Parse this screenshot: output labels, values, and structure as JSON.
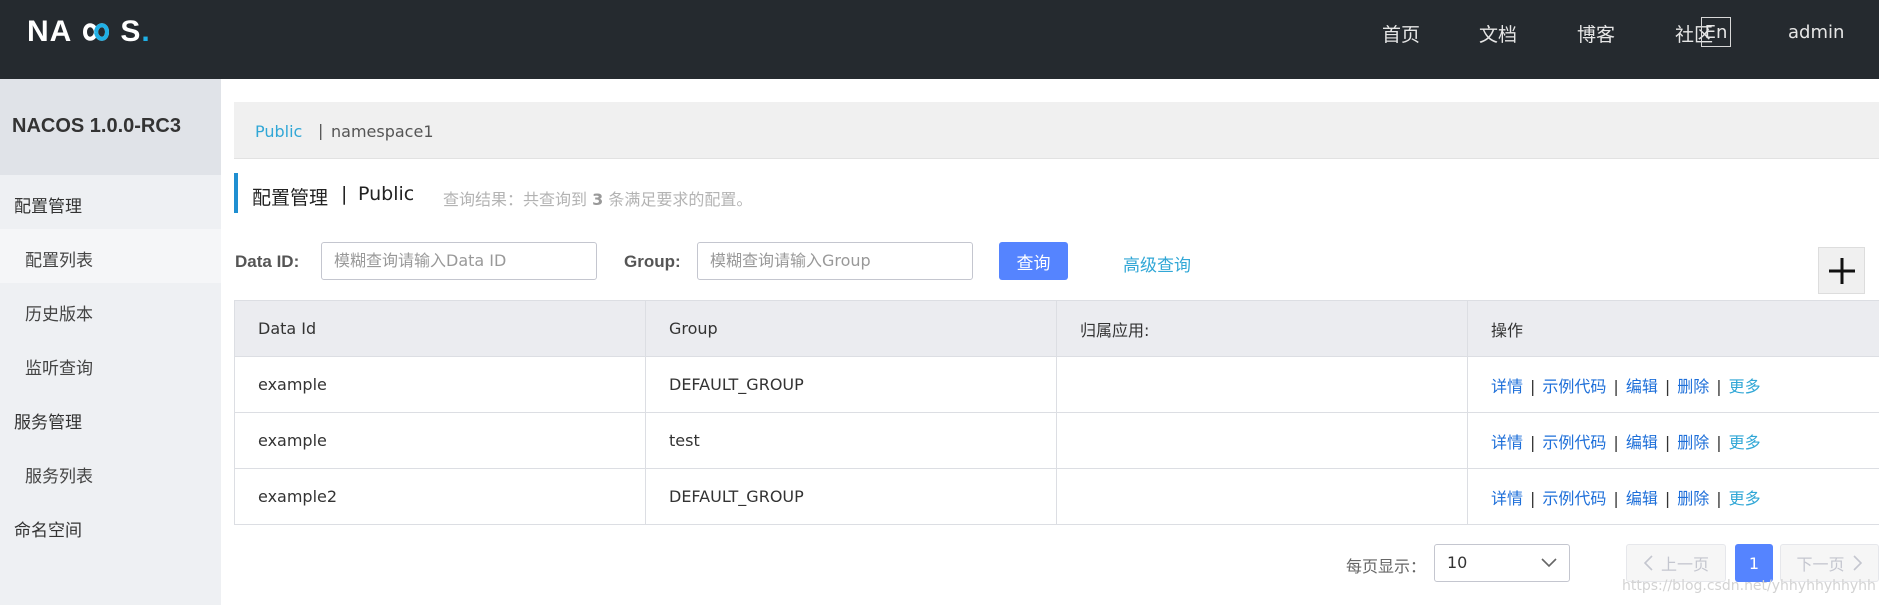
{
  "header": {
    "logo_left": "NA",
    "logo_right": "S",
    "logo_dot": ".",
    "nav": [
      "首页",
      "文档",
      "博客",
      "社区"
    ],
    "lang": "En",
    "user": "admin"
  },
  "sidebar": {
    "title": "NACOS 1.0.0-RC3",
    "items": [
      {
        "label": "配置管理",
        "level": "group"
      },
      {
        "label": "配置列表",
        "level": "sub",
        "active": true
      },
      {
        "label": "历史版本",
        "level": "sub"
      },
      {
        "label": "监听查询",
        "level": "sub"
      },
      {
        "label": "服务管理",
        "level": "group"
      },
      {
        "label": "服务列表",
        "level": "sub"
      },
      {
        "label": "命名空间",
        "level": "group"
      }
    ]
  },
  "namespaces": {
    "active": "Public",
    "separator": "|",
    "other": "namespace1"
  },
  "page": {
    "title": "配置管理",
    "separator": "|",
    "namespace": "Public",
    "result_prefix": "查询结果：共查询到",
    "result_count": "3",
    "result_suffix": "条满足要求的配置。"
  },
  "search": {
    "dataid_label": "Data ID:",
    "dataid_placeholder": "模糊查询请输入Data ID",
    "group_label": "Group:",
    "group_placeholder": "模糊查询请输入Group",
    "query_button": "查询",
    "advanced_link": "高级查询"
  },
  "table": {
    "columns": [
      "Data Id",
      "Group",
      "归属应用:",
      "操作"
    ],
    "rows": [
      {
        "data_id": "example",
        "group": "DEFAULT_GROUP",
        "app": ""
      },
      {
        "data_id": "example",
        "group": "test",
        "app": ""
      },
      {
        "data_id": "example2",
        "group": "DEFAULT_GROUP",
        "app": ""
      }
    ],
    "actions": {
      "detail": "详情",
      "sample": "示例代码",
      "edit": "编辑",
      "delete": "删除",
      "more": "更多"
    }
  },
  "pagination": {
    "page_size_label": "每页显示：",
    "page_size": "10",
    "prev": "上一页",
    "current": "1",
    "next": "下一页"
  },
  "watermark": "https://blog.csdn.net/yhhyhhyhhyhh",
  "colors": {
    "topbar": "#252a2f",
    "accent_blue": "#5584ff",
    "link_cyan": "#31a7d6",
    "action_blue": "#1e6fd9"
  }
}
